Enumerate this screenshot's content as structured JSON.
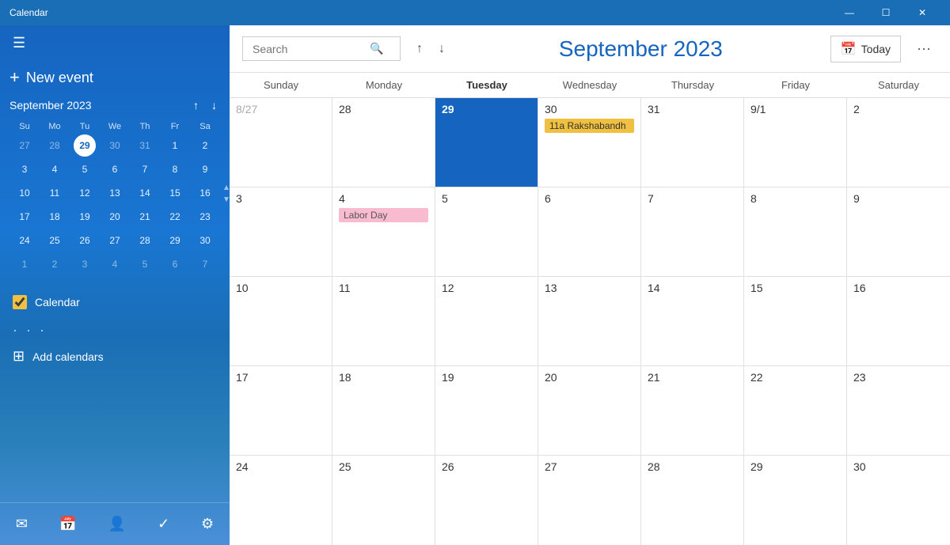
{
  "window": {
    "title": "Calendar",
    "controls": {
      "minimize": "—",
      "maximize": "☐",
      "close": "✕"
    }
  },
  "sidebar": {
    "hamburger": "☰",
    "new_event_label": "New event",
    "mini_calendar": {
      "title": "September 2023",
      "prev_label": "↑",
      "next_label": "↓",
      "days_of_week": [
        "Su",
        "Mo",
        "Tu",
        "We",
        "Th",
        "Fr",
        "Sa"
      ],
      "weeks": [
        [
          "27",
          "28",
          "29",
          "30",
          "31",
          "1",
          "2"
        ],
        [
          "3",
          "4",
          "5",
          "6",
          "7",
          "8",
          "9"
        ],
        [
          "10",
          "11",
          "12",
          "13",
          "14",
          "15",
          "16"
        ],
        [
          "17",
          "18",
          "19",
          "20",
          "21",
          "22",
          "23"
        ],
        [
          "24",
          "25",
          "26",
          "27",
          "28",
          "29",
          "30"
        ],
        [
          "1",
          "2",
          "3",
          "4",
          "5",
          "6",
          "7"
        ]
      ],
      "other_month_days": [
        "27",
        "28",
        "31",
        "1",
        "2",
        "1",
        "2",
        "3",
        "4",
        "5",
        "6",
        "7"
      ],
      "selected_day": "29",
      "today_day": "29"
    },
    "calendar_checkbox_label": "Calendar",
    "dots": "· · ·",
    "add_calendars_label": "Add calendars",
    "footer_icons": [
      "mail",
      "calendar",
      "people",
      "check",
      "gear"
    ]
  },
  "toolbar": {
    "search_placeholder": "Search",
    "nav_up": "↑",
    "nav_down": "↓",
    "month_title": "September 2023",
    "today_label": "Today",
    "more_label": "···"
  },
  "calendar": {
    "days_of_week": [
      "Sunday",
      "Monday",
      "Tuesday",
      "Wednesday",
      "Thursday",
      "Friday",
      "Saturday"
    ],
    "weeks": [
      {
        "days": [
          {
            "num": "8/27",
            "events": [],
            "other_month": true
          },
          {
            "num": "28",
            "events": [],
            "other_month": false
          },
          {
            "num": "29",
            "events": [],
            "other_month": false,
            "today": true
          },
          {
            "num": "30",
            "events": [
              {
                "label": "11a Rakshabandh",
                "type": "yellow"
              }
            ],
            "other_month": false
          },
          {
            "num": "31",
            "events": [],
            "other_month": false
          },
          {
            "num": "9/1",
            "events": [],
            "other_month": false
          },
          {
            "num": "2",
            "events": [],
            "other_month": false
          }
        ]
      },
      {
        "days": [
          {
            "num": "3",
            "events": [],
            "other_month": false
          },
          {
            "num": "4",
            "events": [
              {
                "label": "Labor Day",
                "type": "pink"
              }
            ],
            "other_month": false
          },
          {
            "num": "5",
            "events": [],
            "other_month": false
          },
          {
            "num": "6",
            "events": [],
            "other_month": false
          },
          {
            "num": "7",
            "events": [],
            "other_month": false
          },
          {
            "num": "8",
            "events": [],
            "other_month": false
          },
          {
            "num": "9",
            "events": [],
            "other_month": false
          }
        ]
      },
      {
        "days": [
          {
            "num": "10",
            "events": [],
            "other_month": false
          },
          {
            "num": "11",
            "events": [],
            "other_month": false
          },
          {
            "num": "12",
            "events": [],
            "other_month": false
          },
          {
            "num": "13",
            "events": [],
            "other_month": false
          },
          {
            "num": "14",
            "events": [],
            "other_month": false
          },
          {
            "num": "15",
            "events": [],
            "other_month": false
          },
          {
            "num": "16",
            "events": [],
            "other_month": false
          }
        ]
      },
      {
        "days": [
          {
            "num": "17",
            "events": [],
            "other_month": false
          },
          {
            "num": "18",
            "events": [],
            "other_month": false
          },
          {
            "num": "19",
            "events": [],
            "other_month": false
          },
          {
            "num": "20",
            "events": [],
            "other_month": false
          },
          {
            "num": "21",
            "events": [],
            "other_month": false
          },
          {
            "num": "22",
            "events": [],
            "other_month": false
          },
          {
            "num": "23",
            "events": [],
            "other_month": false
          }
        ]
      },
      {
        "days": [
          {
            "num": "24",
            "events": [],
            "other_month": false
          },
          {
            "num": "25",
            "events": [],
            "other_month": false
          },
          {
            "num": "26",
            "events": [],
            "other_month": false
          },
          {
            "num": "27",
            "events": [],
            "other_month": false
          },
          {
            "num": "28",
            "events": [],
            "other_month": false
          },
          {
            "num": "29",
            "events": [],
            "other_month": false
          },
          {
            "num": "30",
            "events": [],
            "other_month": false
          }
        ]
      }
    ]
  }
}
